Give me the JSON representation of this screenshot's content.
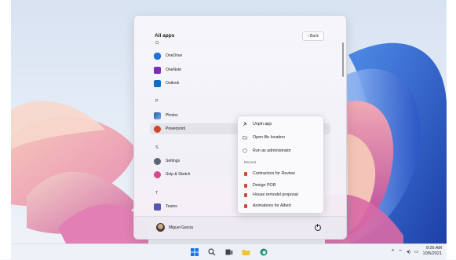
{
  "start_menu": {
    "header": "All apps",
    "back_label": "‹  Back",
    "groups": [
      {
        "letter": "O",
        "apps": [
          {
            "name": "OneDrive",
            "icon": "onedrive-icon",
            "color": "#1e73d8"
          },
          {
            "name": "OneNote",
            "icon": "onenote-icon",
            "color": "#7a2fb8"
          },
          {
            "name": "Outlook",
            "icon": "outlook-icon",
            "color": "#0f6cc4"
          }
        ]
      },
      {
        "letter": "P",
        "apps": [
          {
            "name": "Photos",
            "icon": "photos-icon",
            "color": "#2a5aa8"
          },
          {
            "name": "Powerpoint",
            "icon": "powerpoint-icon",
            "color": "#d24726"
          }
        ]
      },
      {
        "letter": "S",
        "apps": [
          {
            "name": "Settings",
            "icon": "settings-icon",
            "color": "#5b6573"
          },
          {
            "name": "Snip & Sketch",
            "icon": "snip-sketch-icon",
            "color": "#d8498a"
          }
        ]
      },
      {
        "letter": "T",
        "apps": [
          {
            "name": "Teams",
            "icon": "teams-icon",
            "color": "#5558af"
          }
        ]
      }
    ],
    "user": {
      "name": "Miguel Garcia"
    }
  },
  "context_menu": {
    "items": [
      {
        "label": "Unpin app",
        "icon": "unpin-icon"
      },
      {
        "label": "Open file location",
        "icon": "folder-icon"
      },
      {
        "label": "Run as administrator",
        "icon": "shield-icon"
      }
    ],
    "recent_label": "Recent",
    "recent": [
      "Contractors for Review",
      "Design POR",
      "House remodel proposal",
      "Animations for Albert"
    ]
  },
  "taskbar": {
    "icons": [
      "windows-start-icon",
      "search-icon",
      "task-view-icon",
      "file-explorer-icon",
      "edge-icon"
    ],
    "tray_time": "9:26 AM",
    "tray_date": "10/5/2021"
  }
}
